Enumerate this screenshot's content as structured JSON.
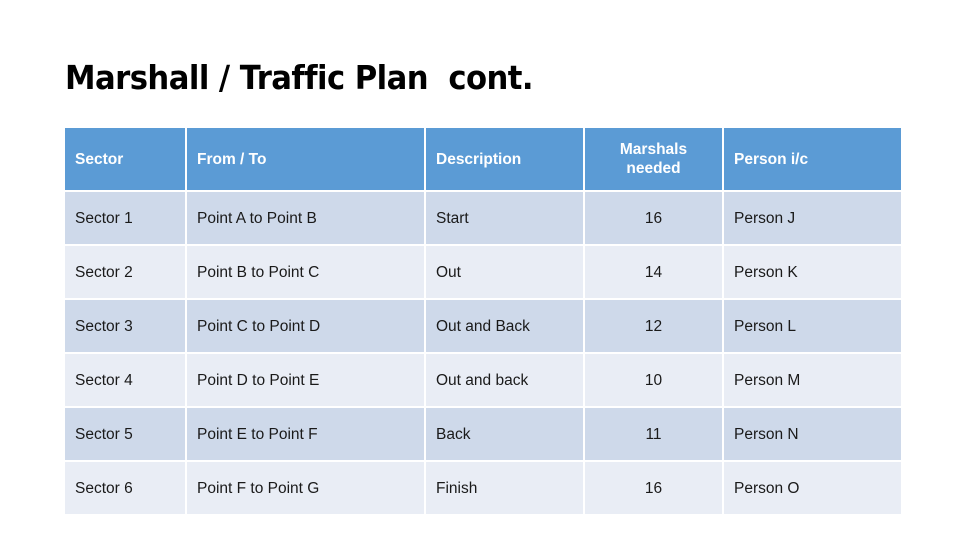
{
  "slide": {
    "title": "Marshall / Traffic Plan  cont.",
    "background_color": "#ffffff"
  },
  "theme": {
    "header_fill": "#5b9bd5",
    "header_text_color": "#ffffff",
    "row_band_dark": "#ced9ea",
    "row_band_light": "#e9edf5",
    "body_text_color": "#1a1a1a"
  },
  "table": {
    "columns": [
      {
        "label": "Sector",
        "align": "left"
      },
      {
        "label": "From / To",
        "align": "left"
      },
      {
        "label": "Description",
        "align": "left"
      },
      {
        "label": "Marshals needed",
        "align": "center"
      },
      {
        "label": "Person i/c",
        "align": "left"
      }
    ],
    "rows": [
      {
        "sector": "Sector 1",
        "from_to": "Point A to Point B",
        "description": "Start",
        "marshals_needed": "16",
        "person_ic": "Person J"
      },
      {
        "sector": "Sector 2",
        "from_to": "Point B to Point C",
        "description": "Out",
        "marshals_needed": "14",
        "person_ic": "Person K"
      },
      {
        "sector": "Sector 3",
        "from_to": "Point C to Point D",
        "description": "Out and Back",
        "marshals_needed": "12",
        "person_ic": "Person L"
      },
      {
        "sector": "Sector 4",
        "from_to": "Point D to Point E",
        "description": "Out and back",
        "marshals_needed": "10",
        "person_ic": "Person M"
      },
      {
        "sector": "Sector 5",
        "from_to": "Point E to Point F",
        "description": "Back",
        "marshals_needed": "11",
        "person_ic": "Person N"
      },
      {
        "sector": "Sector 6",
        "from_to": "Point F to Point G",
        "description": "Finish",
        "marshals_needed": "16",
        "person_ic": "Person O"
      }
    ]
  }
}
